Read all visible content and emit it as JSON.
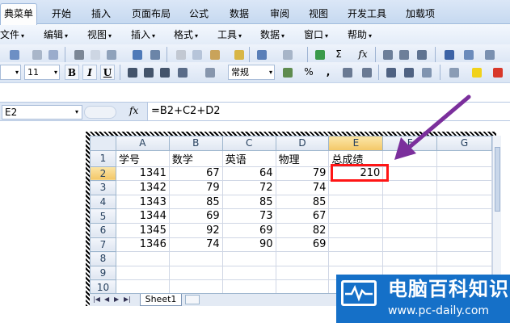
{
  "ribbon": {
    "tabs": [
      "典菜单",
      "开始",
      "插入",
      "页面布局",
      "公式",
      "数据",
      "审阅",
      "视图",
      "开发工具",
      "加载项"
    ]
  },
  "menubar": {
    "items": [
      "文件",
      "编辑",
      "视图",
      "插入",
      "格式",
      "工具",
      "数据",
      "窗口",
      "帮助"
    ]
  },
  "toolbar": {
    "font_size": "11",
    "bold": "B",
    "italic": "I",
    "underline": "U",
    "number_format": "常规",
    "percent": "%",
    "comma": ",",
    "sigma": "Σ",
    "fx_small": "fx"
  },
  "formula_bar": {
    "cell_ref": "E2",
    "fx_label": "fx",
    "formula": "=B2+C2+D2"
  },
  "sheet": {
    "columns": [
      "A",
      "B",
      "C",
      "D",
      "E",
      "F",
      "G"
    ],
    "row_numbers": [
      "1",
      "2",
      "3",
      "4",
      "5",
      "6",
      "7",
      "8",
      "9",
      "10"
    ],
    "header_row": [
      "学号",
      "数学",
      "英语",
      "物理",
      "总成绩"
    ],
    "rows": [
      [
        "1341",
        "67",
        "64",
        "79",
        "210"
      ],
      [
        "1342",
        "79",
        "72",
        "74",
        ""
      ],
      [
        "1343",
        "85",
        "85",
        "85",
        ""
      ],
      [
        "1344",
        "69",
        "73",
        "67",
        ""
      ],
      [
        "1345",
        "92",
        "69",
        "82",
        ""
      ],
      [
        "1346",
        "74",
        "90",
        "69",
        ""
      ]
    ],
    "tab_name": "Sheet1",
    "selected_cell": "E2"
  },
  "annotation": {
    "arrow_color": "#7b2f9c",
    "highlight_color": "#ff1515"
  },
  "watermark": {
    "title": "电脑百科知识",
    "url": "www.pc-daily.com"
  }
}
